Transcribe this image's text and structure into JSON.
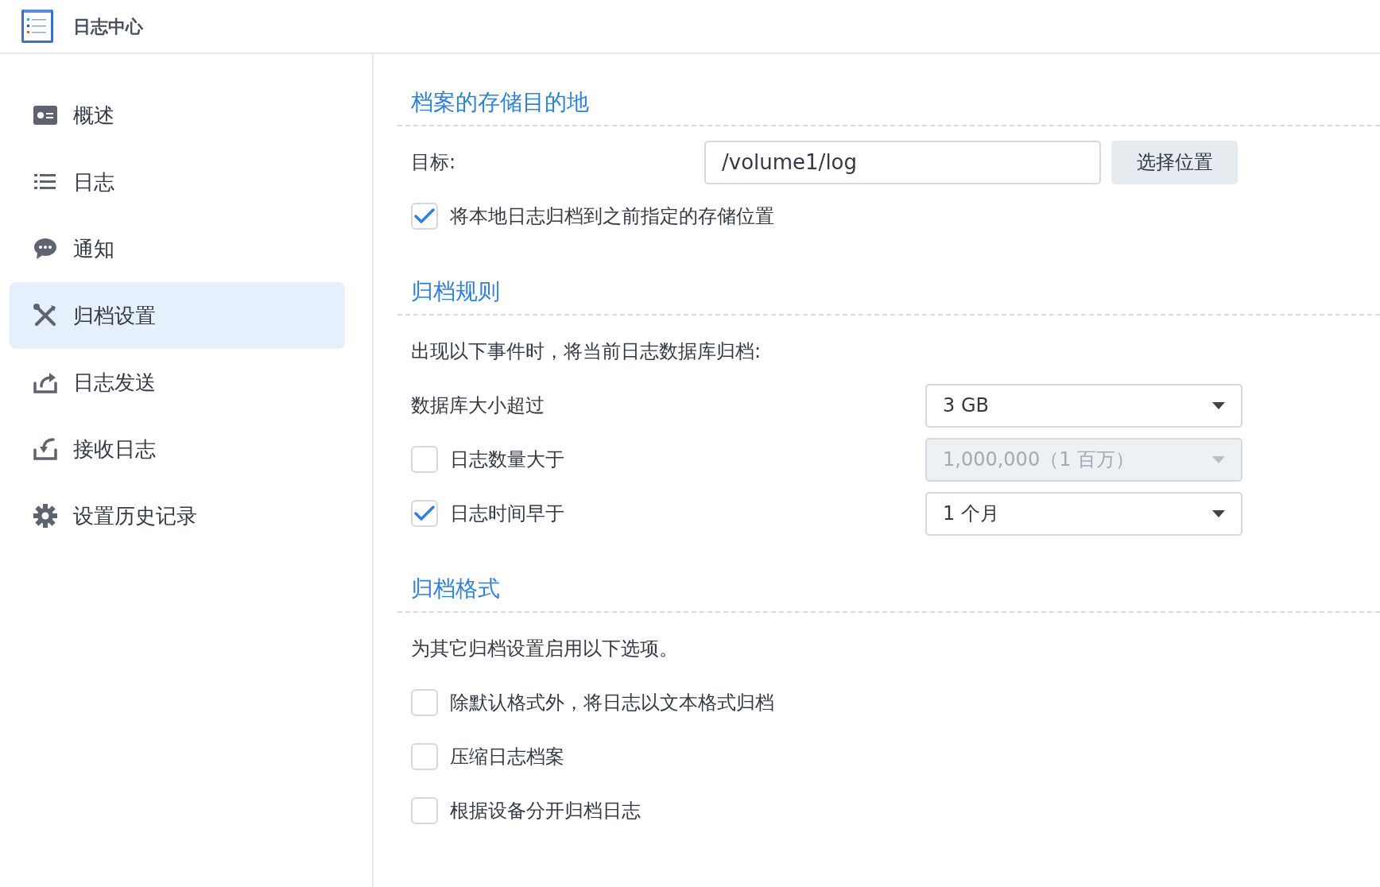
{
  "app": {
    "title": "日志中心"
  },
  "sidebar": {
    "items": [
      {
        "label": "概述",
        "selected": false
      },
      {
        "label": "日志",
        "selected": false
      },
      {
        "label": "通知",
        "selected": false
      },
      {
        "label": "归档设置",
        "selected": true
      },
      {
        "label": "日志发送",
        "selected": false
      },
      {
        "label": "接收日志",
        "selected": false
      },
      {
        "label": "设置历史记录",
        "selected": false
      }
    ]
  },
  "sections": [
    {
      "title": "档案的存储目的地",
      "rows": [
        {
          "kind": "field",
          "label": "目标:",
          "value": "/volume1/log",
          "button": "选择位置"
        },
        {
          "kind": "checkbox",
          "label": "将本地日志归档到之前指定的存储位置",
          "checked": true
        }
      ]
    },
    {
      "title": "归档规则",
      "rows": [
        {
          "kind": "text",
          "text": "出现以下事件时，将当前日志数据库归档:"
        },
        {
          "kind": "select",
          "label": "数据库大小超过",
          "value": "3 GB",
          "disabled": false
        },
        {
          "kind": "checkbox-select",
          "label": "日志数量大于",
          "checked": false,
          "value": "1,000,000（1 百万）",
          "disabled": true
        },
        {
          "kind": "checkbox-select",
          "label": "日志时间早于",
          "checked": true,
          "value": "1 个月",
          "disabled": false
        }
      ]
    },
    {
      "title": "归档格式",
      "rows": [
        {
          "kind": "text",
          "text": "为其它归档设置启用以下选项。"
        },
        {
          "kind": "checkbox",
          "label": "除默认格式外，将日志以文本格式归档",
          "checked": false
        },
        {
          "kind": "checkbox",
          "label": "压缩日志档案",
          "checked": false
        },
        {
          "kind": "checkbox",
          "label": "根据设备分开归档日志",
          "checked": false
        }
      ]
    }
  ]
}
